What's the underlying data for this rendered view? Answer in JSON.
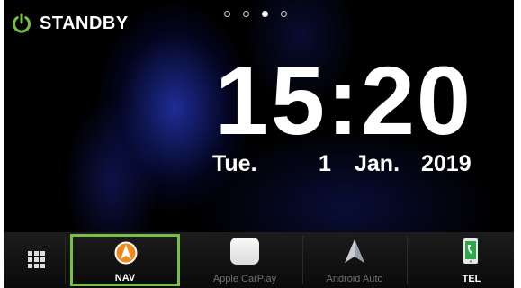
{
  "status": {
    "label": "STANDBY",
    "icon": "power-icon",
    "accent": "#78c043"
  },
  "pager": {
    "pages": 4,
    "active_index": 2
  },
  "clock": {
    "time": "15:20"
  },
  "date": {
    "day": "Tue.",
    "number": "1",
    "month": "Jan.",
    "year": "2019"
  },
  "dock": {
    "apps_button_icon": "grid-icon",
    "items": [
      {
        "label": "NAV",
        "icon": "navigation-arrow-icon",
        "selected": true
      },
      {
        "label": "Apple CarPlay",
        "icon": "carplay-icon",
        "selected": false
      },
      {
        "label": "Android Auto",
        "icon": "android-auto-icon",
        "selected": false
      },
      {
        "label": "TEL",
        "icon": "phone-icon",
        "selected": false
      }
    ],
    "highlight_color": "#78c043"
  }
}
